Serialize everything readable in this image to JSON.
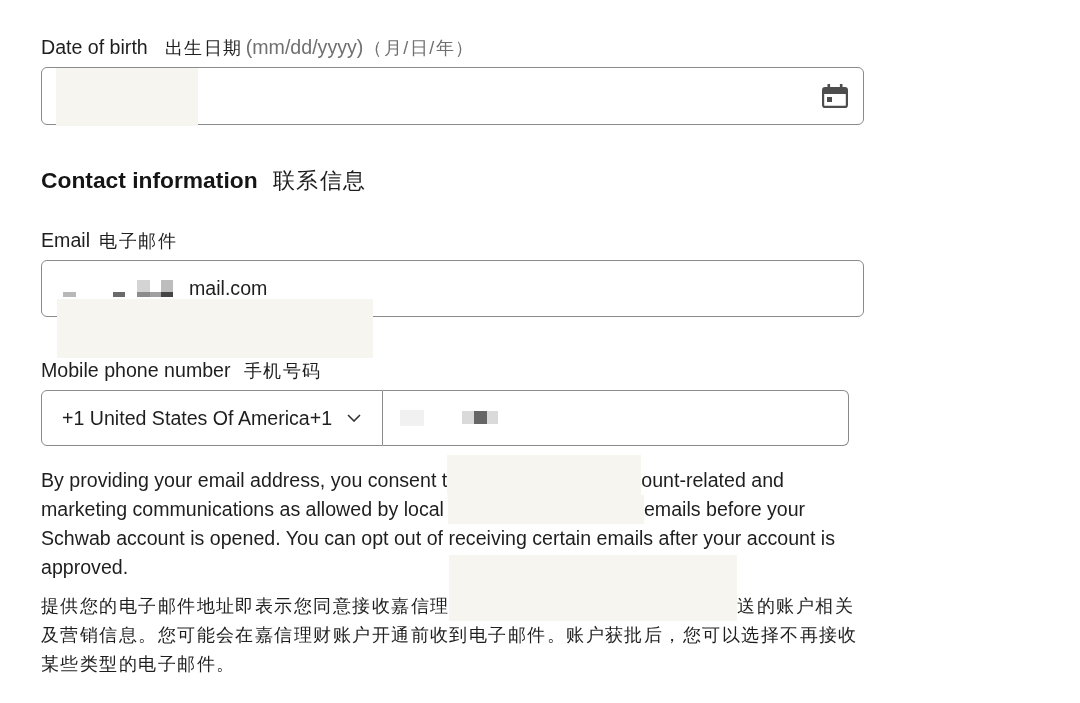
{
  "date_of_birth": {
    "label": "Date of birth",
    "label_zh": "出生日期",
    "hint": "(mm/dd/yyyy)",
    "hint_zh": "（月/日/年）",
    "redacted": true
  },
  "contact_information": {
    "heading": "Contact information",
    "heading_zh": "联系信息"
  },
  "email": {
    "label": "Email",
    "label_zh": "电子邮件",
    "obscured": true,
    "value": "mail.com",
    "redacted": true
  },
  "mobile_phone": {
    "label": "Mobile phone number",
    "label_zh": "手机号码",
    "country_code": "+1 United States Of America+1",
    "obscured": true
  },
  "consent_notice": [
    [
      {
        "kind": "text",
        "text": "By providing your email address, you consent t"
      },
      {
        "kind": "redacted"
      },
      {
        "kind": "text",
        "text": "ount-related and"
      }
    ],
    [
      {
        "kind": "text",
        "text": "marketing communications as allowed by local"
      },
      {
        "kind": "redacted"
      },
      {
        "kind": "text",
        "text": "emails before your"
      }
    ],
    [
      {
        "kind": "text",
        "text": "Schwab account is opened. You can opt out of receiving certain emails after your account is"
      }
    ],
    [
      {
        "kind": "text",
        "text": "approved."
      }
    ]
  ],
  "consent_notice_zh": [
    [
      {
        "kind": "text",
        "text": "提供您的电子邮件地址即表示您同意接收嘉信理"
      },
      {
        "kind": "redacted"
      },
      {
        "kind": "text",
        "text": "送的账户相关"
      }
    ],
    [
      {
        "kind": "text",
        "text": "及营销信息。您可能会在嘉信理财账户开通前收到电子邮件。账户获批后，您可以选择不再接收"
      }
    ],
    [
      {
        "kind": "text",
        "text": "某些类型的电子邮件。"
      }
    ]
  ]
}
